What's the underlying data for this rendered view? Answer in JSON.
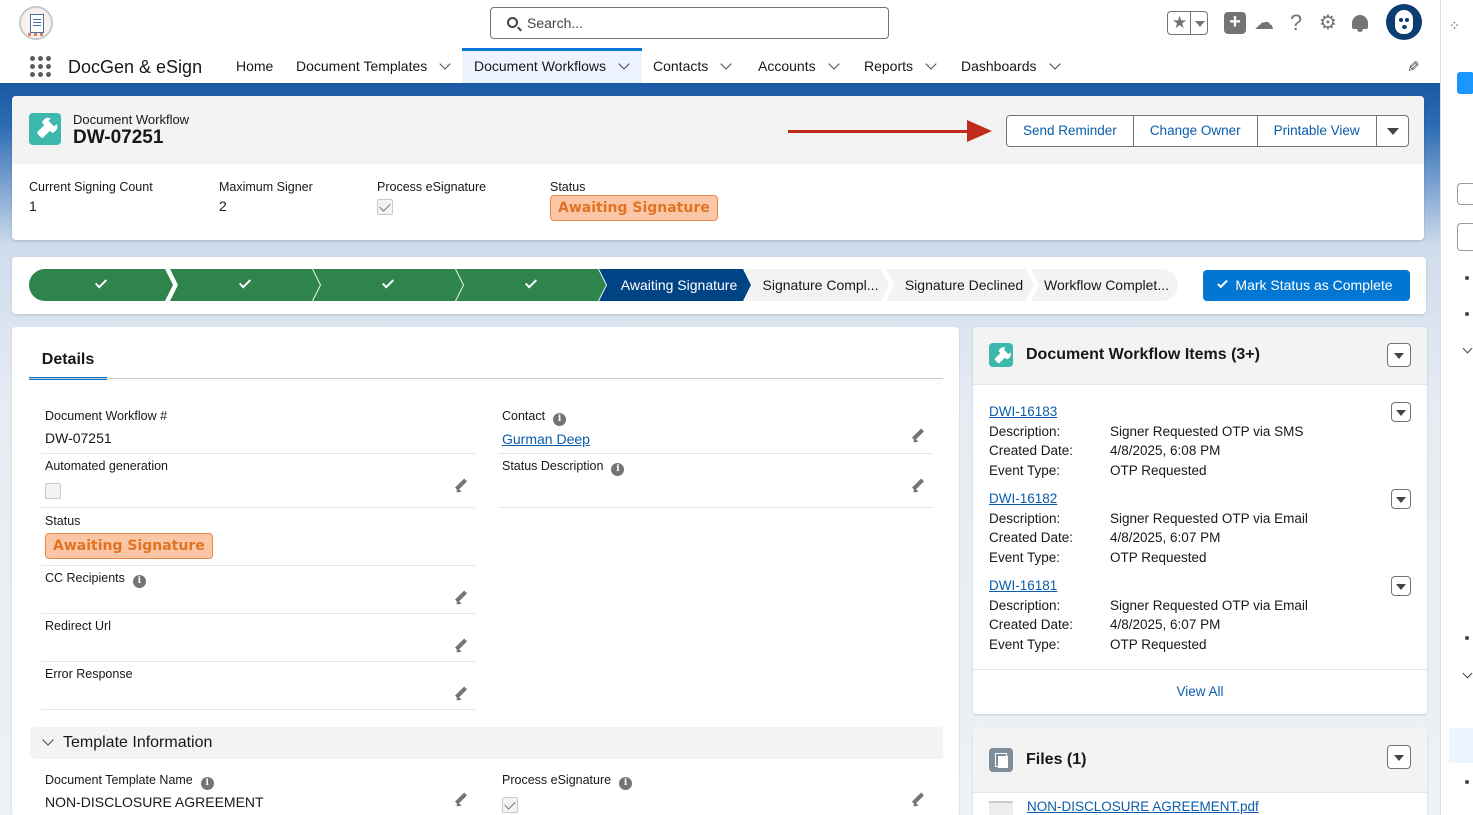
{
  "header": {
    "search_placeholder": "Search...",
    "icons": [
      "favorites-star-icon",
      "global-actions-plus-icon",
      "trailhead-icon",
      "help-icon",
      "setup-gear-icon",
      "notifications-bell-icon",
      "user-avatar"
    ]
  },
  "nav": {
    "app_name": "DocGen & eSign",
    "items": [
      {
        "label": "Home",
        "dropdown": false
      },
      {
        "label": "Document Templates",
        "dropdown": true
      },
      {
        "label": "Document Workflows",
        "dropdown": true,
        "active": true
      },
      {
        "label": "Contacts",
        "dropdown": true
      },
      {
        "label": "Accounts",
        "dropdown": true
      },
      {
        "label": "Reports",
        "dropdown": true
      },
      {
        "label": "Dashboards",
        "dropdown": true
      }
    ]
  },
  "record": {
    "object_label": "Document Workflow",
    "name": "DW-07251",
    "actions": [
      "Send Reminder",
      "Change Owner",
      "Printable View"
    ],
    "highlights": [
      {
        "label": "Current Signing Count",
        "value": "1"
      },
      {
        "label": "Maximum Signer",
        "value": "2"
      },
      {
        "label": "Process eSignature",
        "checked": true
      },
      {
        "label": "Status",
        "value": "Awaiting Signature"
      }
    ]
  },
  "path": {
    "completed_steps": 4,
    "current": "Awaiting Signature",
    "upcoming": [
      "Signature Compl...",
      "Signature Declined",
      "Workflow Complet..."
    ],
    "mark_button": "Mark Status as Complete"
  },
  "details": {
    "tab": "Details",
    "doc_number_label": "Document Workflow #",
    "doc_number": "DW-07251",
    "contact_label": "Contact",
    "contact": "Gurman Deep",
    "automated_label": "Automated generation",
    "automated_checked": false,
    "status_description_label": "Status Description",
    "status_label": "Status",
    "status": "Awaiting Signature",
    "cc_label": "CC Recipients",
    "redirect_label": "Redirect Url",
    "error_label": "Error Response",
    "section_title": "Template Information",
    "template_name_label": "Document Template Name",
    "template_name": "NON-DISCLOSURE AGREEMENT",
    "process_esig_label": "Process eSignature",
    "process_esig_checked": true
  },
  "related": {
    "title": "Document Workflow Items (3+)",
    "items": [
      {
        "id": "DWI-16183",
        "description": "Signer Requested OTP via SMS",
        "created": "4/8/2025, 6:08 PM",
        "event": "OTP Requested"
      },
      {
        "id": "DWI-16182",
        "description": "Signer Requested OTP via Email",
        "created": "4/8/2025, 6:07 PM",
        "event": "OTP Requested"
      },
      {
        "id": "DWI-16181",
        "description": "Signer Requested OTP via Email",
        "created": "4/8/2025, 6:07 PM",
        "event": "OTP Requested"
      }
    ],
    "labels": {
      "description": "Description:",
      "created": "Created Date:",
      "event": "Event Type:"
    },
    "view_all": "View All"
  },
  "files": {
    "title": "Files (1)",
    "file_name": "NON-DISCLOSURE AGREEMENT.pdf"
  },
  "colors": {
    "brand_blue": "#0176d3",
    "path_complete": "#2e844a",
    "path_current": "#014486",
    "status_badge_bg": "#fbc6a6",
    "status_badge_text": "#e07324",
    "annotation_arrow": "#c02b1c",
    "record_icon": "#3cb8ad"
  }
}
